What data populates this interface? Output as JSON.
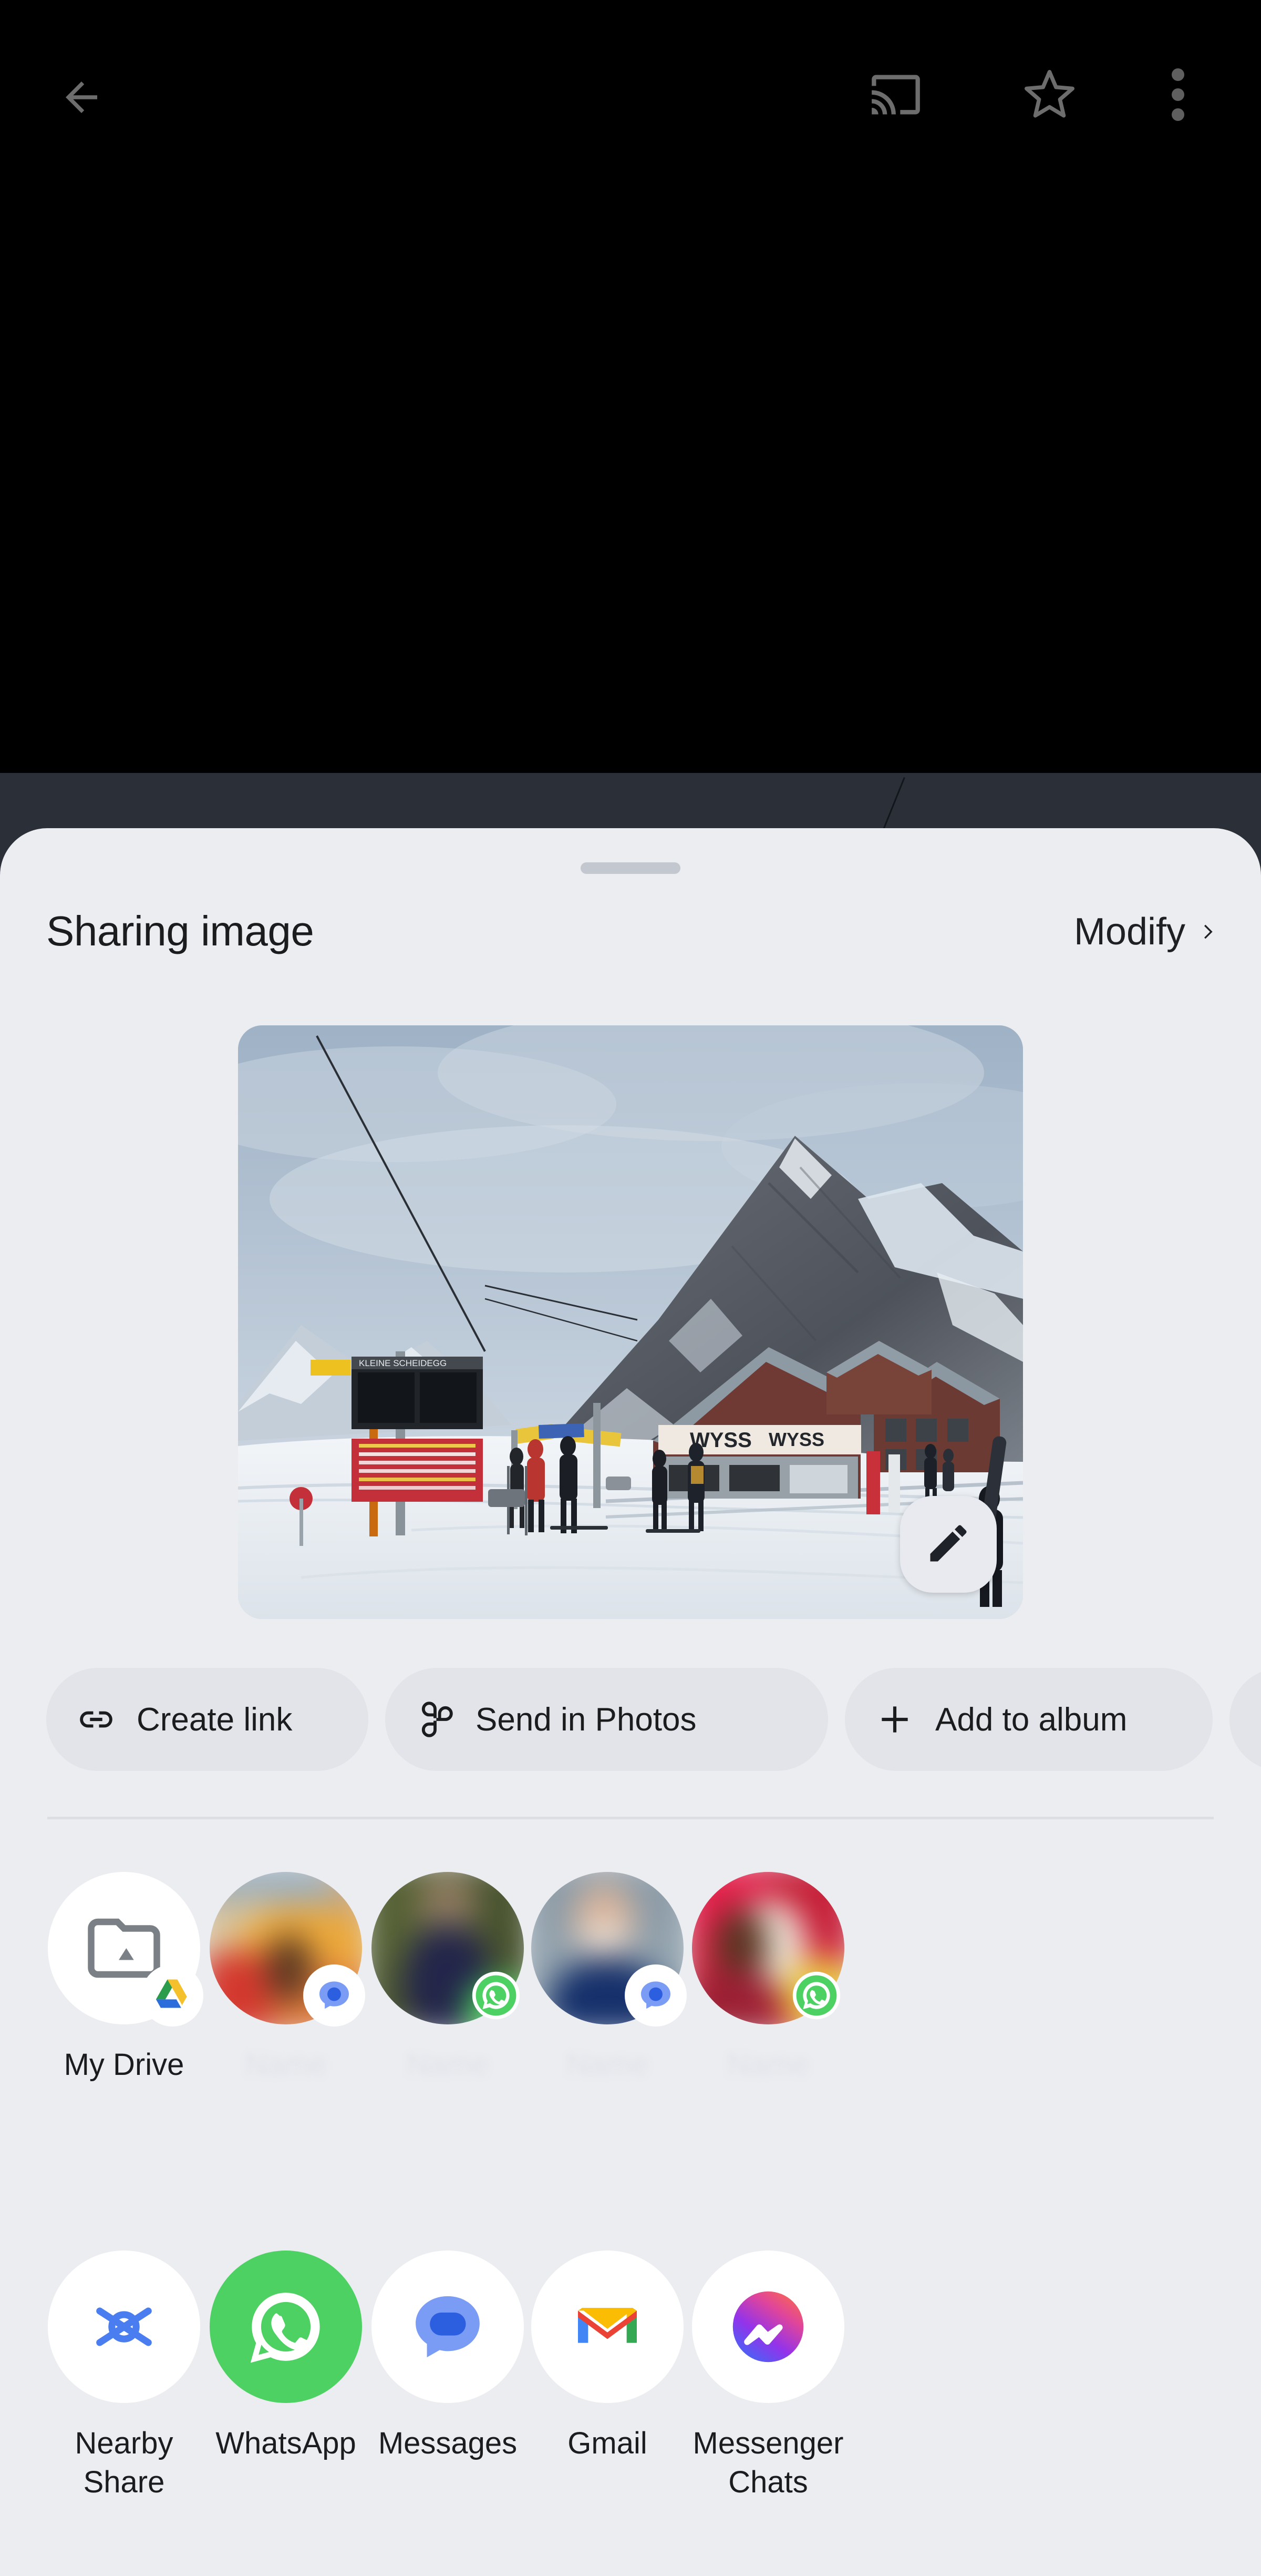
{
  "topbar": {
    "back_icon": "back-arrow-icon",
    "cast_icon": "cast-icon",
    "star_icon": "star-outline-icon",
    "more_icon": "overflow-menu-icon"
  },
  "sheet": {
    "title": "Sharing image",
    "modify_label": "Modify",
    "modify_chevron": "chevron-right-icon",
    "grabber": "drag-handle"
  },
  "preview": {
    "edit_icon": "pencil-edit-icon",
    "alt": "Snowy ski resort at Kleine Scheidegg with the Eiger mountain, chalets and skiers"
  },
  "chips": [
    {
      "label": "Create link",
      "icon": "link-icon"
    },
    {
      "label": "Send in Photos",
      "icon": "google-photos-icon"
    },
    {
      "label": "Add to album",
      "icon": "plus-icon"
    },
    {
      "label": "",
      "icon": "photo-book-icon"
    }
  ],
  "contacts": [
    {
      "label": "My Drive",
      "icon": "drive-folder-icon",
      "badge": "google-drive-badge",
      "blurred": false
    },
    {
      "label": "",
      "icon": "contact-avatar",
      "badge": "messages-badge",
      "blurred": true
    },
    {
      "label": "",
      "icon": "contact-avatar",
      "badge": "whatsapp-badge",
      "blurred": true
    },
    {
      "label": "",
      "icon": "contact-avatar",
      "badge": "messages-badge",
      "blurred": true
    },
    {
      "label": "",
      "icon": "contact-avatar",
      "badge": "whatsapp-badge",
      "blurred": true
    }
  ],
  "apps": [
    {
      "label": "Nearby\nShare",
      "icon": "nearby-share-icon"
    },
    {
      "label": "WhatsApp",
      "icon": "whatsapp-icon"
    },
    {
      "label": "Messages",
      "icon": "messages-icon"
    },
    {
      "label": "Gmail",
      "icon": "gmail-icon"
    },
    {
      "label": "Messenger\nChats",
      "icon": "messenger-icon"
    }
  ],
  "colors": {
    "sheet_bg": "#ebedf1",
    "chip_bg": "#e2e4ea",
    "scrim": "#2b3038",
    "text": "#1b1c1e",
    "whatsapp_green": "#4dd162",
    "messages_blue": "#1a73e8",
    "gmail_red": "#ea4335",
    "nearby_blue": "#4a7df0"
  }
}
